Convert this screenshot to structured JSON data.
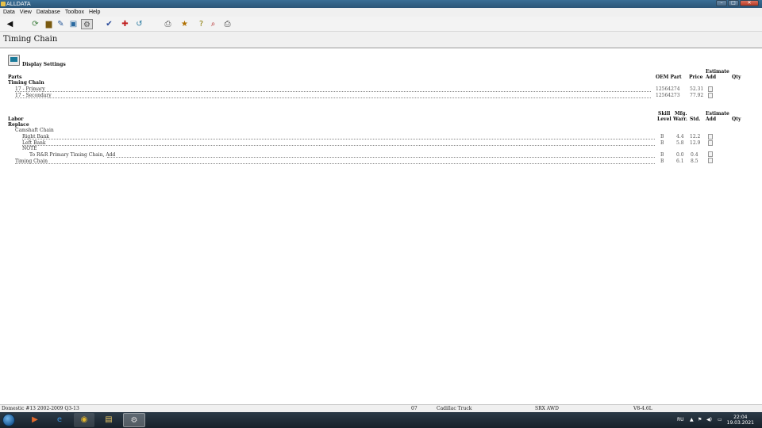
{
  "window": {
    "title": "ALLDATA"
  },
  "menu": [
    "Data",
    "View",
    "Database",
    "Toolbox",
    "Help"
  ],
  "page": {
    "title": "Timing Chain"
  },
  "display_settings": {
    "label": "Display Settings"
  },
  "parts": {
    "section_label": "Parts",
    "group_label": "Timing Chain",
    "headers": {
      "oem_part": "OEM Part",
      "price": "Price",
      "estimate_add_1": "Estimate",
      "estimate_add_2": "Add",
      "qty": "Qty"
    },
    "rows": [
      {
        "name": "17 - Primary",
        "oem": "12564274",
        "price": "52.31"
      },
      {
        "name": "17 - Secondary",
        "oem": "12564273",
        "price": "77.92"
      }
    ]
  },
  "labor": {
    "section_label": "Labor",
    "group_label": "Replace",
    "headers": {
      "skill_1": "Skill",
      "skill_2": "Level",
      "mfg_1": "Mfg.",
      "mfg_2": "Warr.",
      "std": "Std.",
      "estimate_add_1": "Estimate",
      "estimate_add_2": "Add",
      "qty": "Qty"
    },
    "rows": [
      {
        "name": "Camshaft Chain",
        "level": "",
        "skill": "",
        "warr": "",
        "std": ""
      },
      {
        "name": "Right Bank",
        "level": "",
        "skill": "B",
        "warr": "4.4",
        "std": "12.2"
      },
      {
        "name": "Left Bank",
        "level": "",
        "skill": "B",
        "warr": "5.8",
        "std": "12.9"
      },
      {
        "name": "NOTE",
        "level": "",
        "skill": "",
        "warr": "",
        "std": ""
      },
      {
        "name": "To R&R Primary Timing Chain, Add",
        "level": "",
        "skill": "B",
        "warr": "0.0",
        "std": "0.4"
      },
      {
        "name": "Timing Chain",
        "level": "",
        "skill": "B",
        "warr": "6.1",
        "std": "8.5"
      }
    ]
  },
  "status": {
    "database": "Domestic #13 2002-2009 Q3-13",
    "year": "07",
    "make": "Cadillac Truck",
    "model": "SRX AWD",
    "engine": "V8-4.6L"
  },
  "taskbar": {
    "lang": "RU",
    "time": "22:04",
    "date": "19.03.2021"
  }
}
